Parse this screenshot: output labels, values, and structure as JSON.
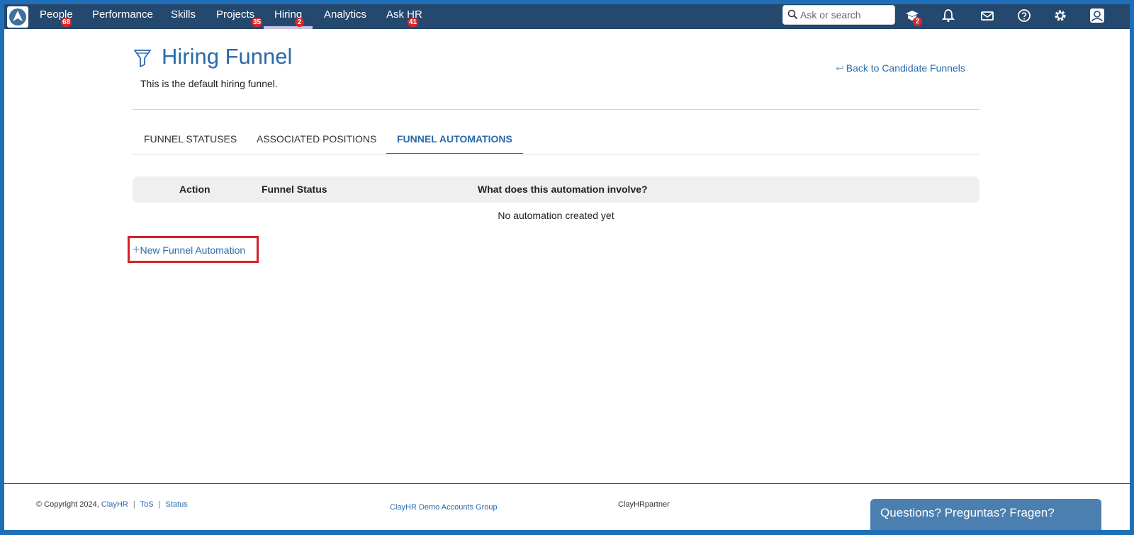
{
  "nav": {
    "items": [
      {
        "label": "People",
        "badge": "68"
      },
      {
        "label": "Performance",
        "badge": ""
      },
      {
        "label": "Skills",
        "badge": ""
      },
      {
        "label": "Projects",
        "badge": "35"
      },
      {
        "label": "Hiring",
        "badge": "2",
        "active": true
      },
      {
        "label": "Analytics",
        "badge": ""
      },
      {
        "label": "Ask HR",
        "badge": "41"
      }
    ],
    "search_placeholder": "Ask or search",
    "icons": [
      {
        "name": "learning-icon",
        "badge": "2"
      },
      {
        "name": "bell-icon",
        "badge": ""
      },
      {
        "name": "mail-icon",
        "badge": ""
      },
      {
        "name": "help-icon",
        "badge": ""
      },
      {
        "name": "gear-icon",
        "badge": ""
      },
      {
        "name": "user-avatar-icon",
        "badge": ""
      }
    ]
  },
  "header": {
    "title": "Hiring Funnel",
    "subtitle": "This is the default hiring funnel.",
    "back_link": "Back to Candidate Funnels"
  },
  "tabs": [
    {
      "label": "FUNNEL STATUSES",
      "active": false
    },
    {
      "label": "ASSOCIATED POSITIONS",
      "active": false
    },
    {
      "label": "FUNNEL AUTOMATIONS",
      "active": true
    }
  ],
  "table": {
    "columns": [
      "Action",
      "Funnel Status",
      "What does this automation involve?"
    ],
    "empty_message": "No automation created yet"
  },
  "new_automation_label": "New Funnel Automation",
  "footer": {
    "copyright": "© Copyright 2024,",
    "company_link": "ClayHR",
    "tos_link": "ToS",
    "status_link": "Status",
    "group": "ClayHR Demo Accounts Group",
    "partner": "ClayHRpartner",
    "chat": "Questions? Preguntas? Fragen?"
  },
  "colors": {
    "nav_bg": "#25486e",
    "accent": "#2a6aab",
    "badge": "#d9262a",
    "highlight_border": "#d62027"
  }
}
